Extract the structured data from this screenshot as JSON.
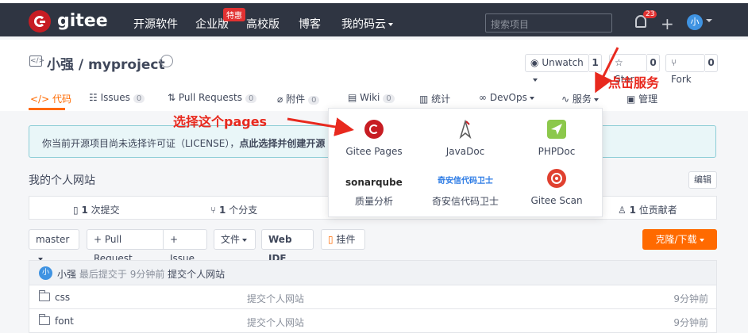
{
  "topnav": {
    "brand": "gitee",
    "links": [
      "开源软件",
      "企业版",
      "高校版",
      "博客",
      "我的码云"
    ],
    "special_badge": "特惠",
    "search_placeholder": "搜索项目",
    "notification_count": "23",
    "avatar_text": "小"
  },
  "project": {
    "title": "小强 / myproject",
    "unwatch_label": "Unwatch",
    "unwatch_count": "1",
    "star_label": "Star",
    "star_count": "0",
    "fork_label": "Fork",
    "fork_count": "0"
  },
  "tabs": [
    {
      "label": "代码",
      "count": ""
    },
    {
      "label": "Issues",
      "count": "0"
    },
    {
      "label": "Pull Requests",
      "count": "0"
    },
    {
      "label": "附件",
      "count": "0"
    },
    {
      "label": "Wiki",
      "count": "0"
    },
    {
      "label": "统计",
      "count": ""
    },
    {
      "label": "DevOps",
      "count": ""
    },
    {
      "label": "服务",
      "count": ""
    },
    {
      "label": "管理",
      "count": ""
    }
  ],
  "license_notice": {
    "text": "你当前开源项目尚未选择许可证（LICENSE），",
    "link": "点此选择并创建开源"
  },
  "description": "我的个人网站",
  "edit_label": "编辑",
  "stats": {
    "commits_count": "1",
    "commits_label": "次提交",
    "branches_count": "1",
    "branches_label": "个分支",
    "contributors_count": "1",
    "contributors_label": "位贡献者"
  },
  "toolbar": {
    "branch": "master",
    "pull_request": "+ Pull Request",
    "issue": "+ Issue",
    "files": "文件",
    "web_ide": "Web IDE",
    "widget": "挂件",
    "clone": "克隆/下载"
  },
  "commit": {
    "avatar_text": "小",
    "author": "小强",
    "prefix": "最后提交于",
    "time": "9分钟前",
    "message": "提交个人网站"
  },
  "files": [
    {
      "name": "css",
      "message": "提交个人网站",
      "time": "9分钟前"
    },
    {
      "name": "font",
      "message": "提交个人网站",
      "time": "9分钟前"
    }
  ],
  "services": [
    {
      "label": "Gitee Pages",
      "icon": "gitee-pages-icon",
      "color": "#c71d23"
    },
    {
      "label": "JavaDoc",
      "icon": "javadoc-icon",
      "color": "#5382a1"
    },
    {
      "label": "PHPDoc",
      "icon": "phpdoc-icon",
      "color": "#8cc84b"
    },
    {
      "label": "质量分析",
      "icon": "sonarqube-icon",
      "color": "#4e9bcd"
    },
    {
      "label": "奇安信代码卫士",
      "icon": "qianxin-icon",
      "color": "#2c7be5"
    },
    {
      "label": "Gitee Scan",
      "icon": "gitee-scan-icon",
      "color": "#e0402f"
    }
  ],
  "sonar_logo": "sonarqube",
  "qianxin_logo": "奇安信代码卫士",
  "annotations": {
    "click_service": "点击服务",
    "select_pages": "选择这个pages"
  },
  "colors": {
    "accent": "#ff6a00",
    "nav_bg": "#2f3542",
    "annotation": "#e8291e"
  }
}
